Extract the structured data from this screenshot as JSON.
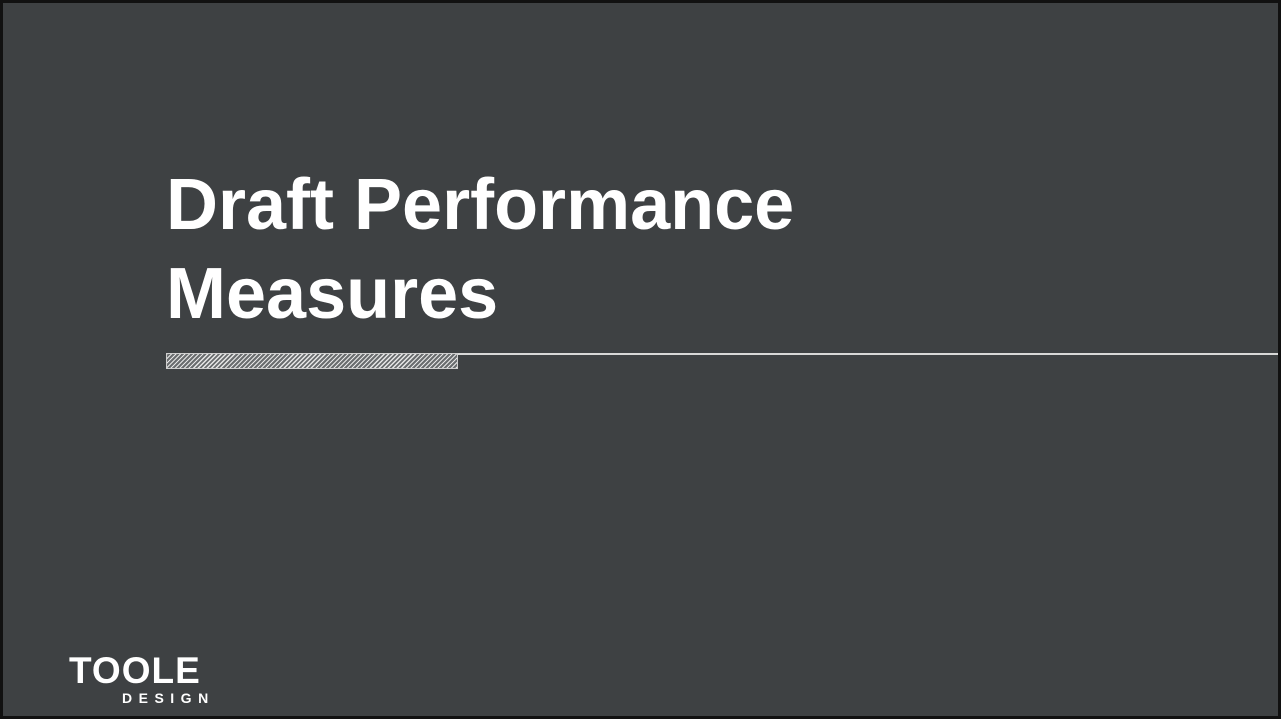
{
  "slide": {
    "title_line_1": "Draft Performance",
    "title_line_2": "Measures",
    "background_color": "#3e4143",
    "accent_color": "#ffffff"
  },
  "logo": {
    "main_text": "TOOLE",
    "sub_text": "DESIGN"
  }
}
